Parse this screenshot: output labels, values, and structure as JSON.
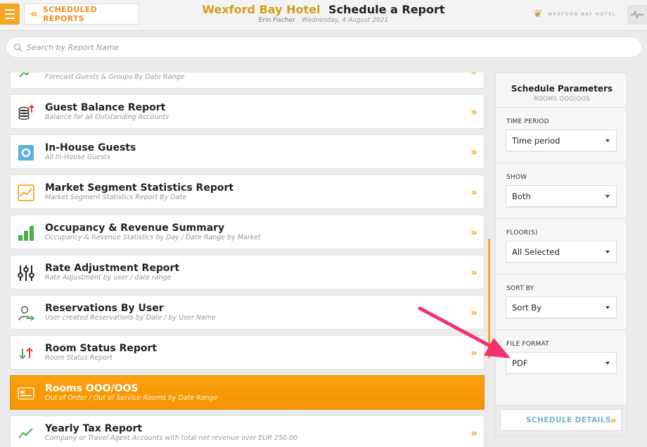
{
  "header": {
    "menu_icon": "hamburger-icon",
    "back_label": "SCHEDULED REPORTS",
    "hotel_name": "Wexford Bay Hotel",
    "page_title": "Schedule a Report",
    "user": "Erin Fischer",
    "date": "Wednesday, 4 August 2021",
    "brand": "WEXFORD BAY HOTEL",
    "activity_icon": "pulse-icon"
  },
  "search": {
    "placeholder": "Search by Report Name"
  },
  "reports": [
    {
      "name": "",
      "desc": "Forecast Guests & Groups By Date Range",
      "icon": "trend-up-icon"
    },
    {
      "name": "Guest Balance Report",
      "desc": "Balance for all Outstanding Accounts",
      "icon": "coins-icon"
    },
    {
      "name": "In-House Guests",
      "desc": "All In-House Guests",
      "icon": "inhouse-icon"
    },
    {
      "name": "Market Segment Statistics Report",
      "desc": "Market Segment Statistics Report By Date",
      "icon": "line-chart-icon"
    },
    {
      "name": "Occupancy & Revenue Summary",
      "desc": "Occupancy & Revenue Statistics by Day / Date Range by Market",
      "icon": "bar-chart-icon"
    },
    {
      "name": "Rate Adjustment Report",
      "desc": "Rate Adjustment by user / date range",
      "icon": "sliders-icon"
    },
    {
      "name": "Reservations By User",
      "desc": "User created Reservations by Date / by User Name",
      "icon": "user-arrow-icon"
    },
    {
      "name": "Room Status Report",
      "desc": "Room Status Report",
      "icon": "up-down-arrows-icon"
    },
    {
      "name": "Rooms OOO/OOS",
      "desc": "Out of Order / Out of Service Rooms by Date Range",
      "icon": "bed-icon"
    },
    {
      "name": "Yearly Tax Report",
      "desc": "Company or Travel Agent Accounts with total net revenue over EUR 250.00",
      "icon": "trend-up-icon"
    }
  ],
  "panel": {
    "title": "Schedule Parameters",
    "subtitle": "ROOMS OOO/OOS",
    "params": [
      {
        "label": "TIME PERIOD",
        "value": "Time period"
      },
      {
        "label": "SHOW",
        "value": "Both"
      },
      {
        "label": "FLOOR(S)",
        "value": "All Selected"
      },
      {
        "label": "SORT BY",
        "value": "Sort By"
      },
      {
        "label": "FILE FORMAT",
        "value": "PDF"
      }
    ],
    "schedule_button": "SCHEDULE DETAILS"
  },
  "colors": {
    "accent": "#f5a623",
    "active": "#f59300",
    "annotation": "#f0326e",
    "link": "#7ab3d3"
  }
}
